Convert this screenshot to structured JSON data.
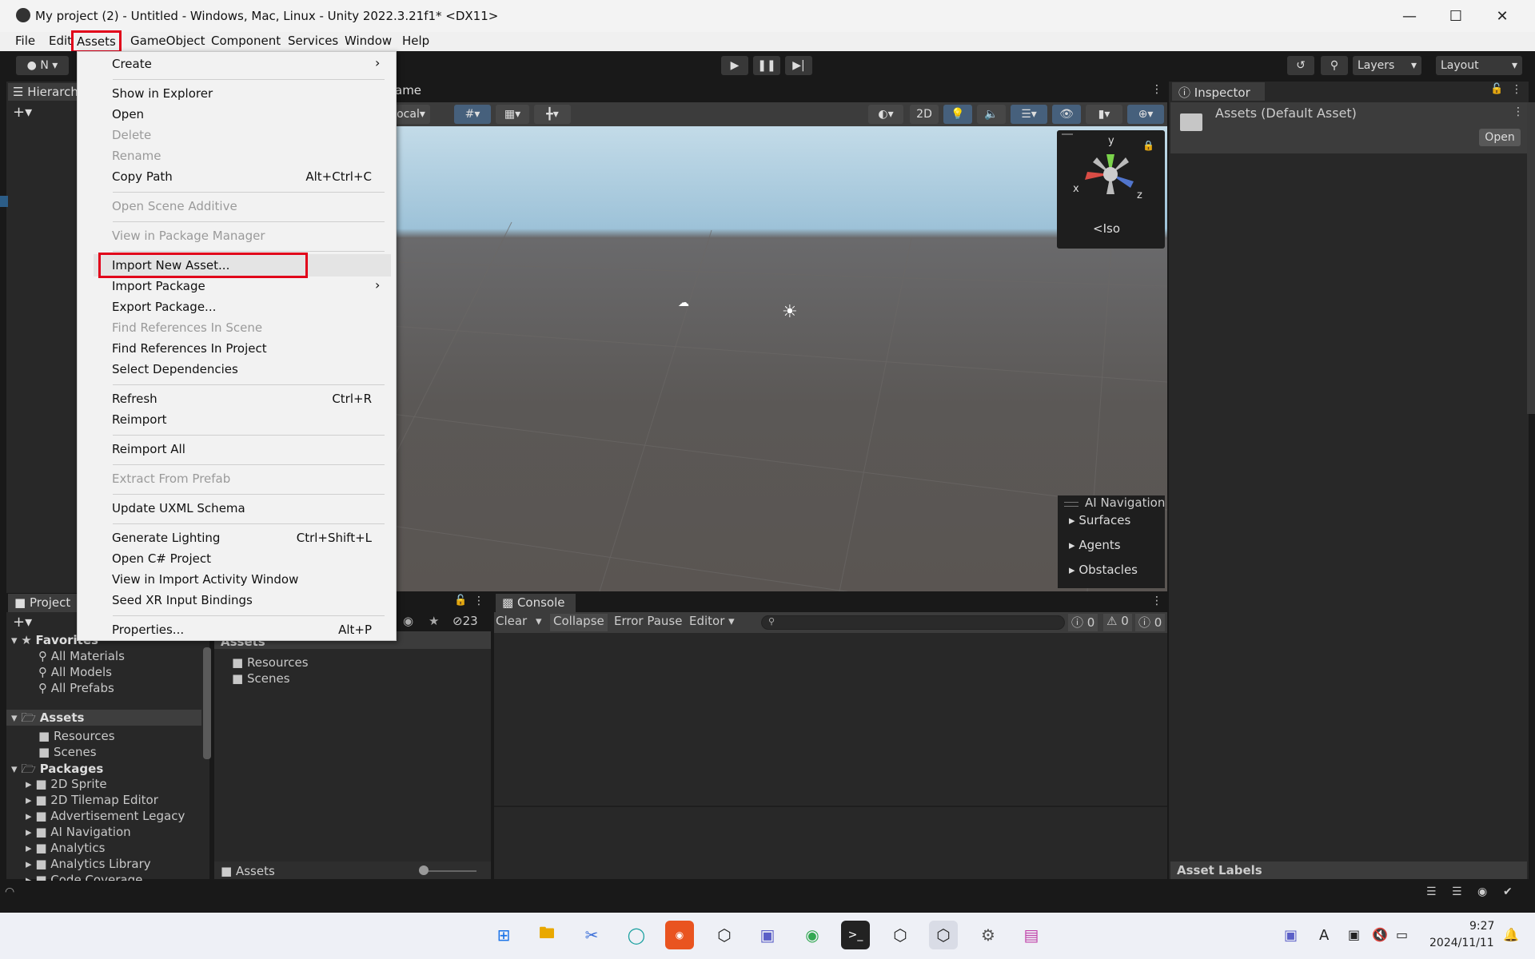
{
  "window": {
    "title": "My project (2) - Untitled - Windows, Mac, Linux - Unity 2022.3.21f1* <DX11>"
  },
  "menubar": [
    "File",
    "Edit",
    "Assets",
    "GameObject",
    "Component",
    "Services",
    "Window",
    "Help"
  ],
  "toolbar": {
    "account": "N",
    "layers": "Layers",
    "layout": "Layout"
  },
  "hierarchy": {
    "tab": "Hierarch"
  },
  "scene": {
    "tab_game": "ame",
    "local": "ocal",
    "btn_2d": "2D",
    "iso": "Iso",
    "axis_x": "x",
    "axis_y": "y",
    "axis_z": "z"
  },
  "ai_navigation": {
    "title": "AI Navigation",
    "items": [
      "Surfaces",
      "Agents",
      "Obstacles"
    ]
  },
  "inspector": {
    "tab": "Inspector",
    "asset_title": "Assets (Default Asset)",
    "open": "Open",
    "asset_labels": "Asset Labels"
  },
  "dropdown": {
    "create": "Create",
    "show_in_explorer": "Show in Explorer",
    "open": "Open",
    "delete": "Delete",
    "rename": "Rename",
    "copy_path": "Copy Path",
    "copy_path_sc": "Alt+Ctrl+C",
    "open_scene_additive": "Open Scene Additive",
    "view_in_package_manager": "View in Package Manager",
    "import_new_asset": "Import New Asset...",
    "import_package": "Import Package",
    "export_package": "Export Package...",
    "find_refs_scene": "Find References In Scene",
    "find_refs_project": "Find References In Project",
    "select_dependencies": "Select Dependencies",
    "refresh": "Refresh",
    "refresh_sc": "Ctrl+R",
    "reimport": "Reimport",
    "reimport_all": "Reimport All",
    "extract_from_prefab": "Extract From Prefab",
    "update_uxml": "Update UXML Schema",
    "generate_lighting": "Generate Lighting",
    "generate_lighting_sc": "Ctrl+Shift+L",
    "open_csharp": "Open C# Project",
    "view_import_activity": "View in Import Activity Window",
    "seed_xr": "Seed XR Input Bindings",
    "properties": "Properties...",
    "properties_sc": "Alt+P"
  },
  "project": {
    "tab": "Project",
    "favorites": "Favorites",
    "fav_items": [
      "All Materials",
      "All Models",
      "All Prefabs"
    ],
    "assets": "Assets",
    "asset_items": [
      "Resources",
      "Scenes"
    ],
    "packages": "Packages",
    "package_items": [
      "2D Sprite",
      "2D Tilemap Editor",
      "Advertisement Legacy",
      "AI Navigation",
      "Analytics",
      "Analytics Library",
      "Code Coverage"
    ],
    "hidden_count": "23",
    "content_header": "Assets",
    "content_items": [
      "Resources",
      "Scenes"
    ],
    "footer_path": "Assets"
  },
  "console": {
    "tab": "Console",
    "clear": "Clear",
    "collapse": "Collapse",
    "error_pause": "Error Pause",
    "editor": "Editor",
    "count_log": "0",
    "count_warn": "0",
    "count_err": "0"
  },
  "taskbar": {
    "time": "9:27",
    "date": "2024/11/11",
    "lang": "A"
  }
}
